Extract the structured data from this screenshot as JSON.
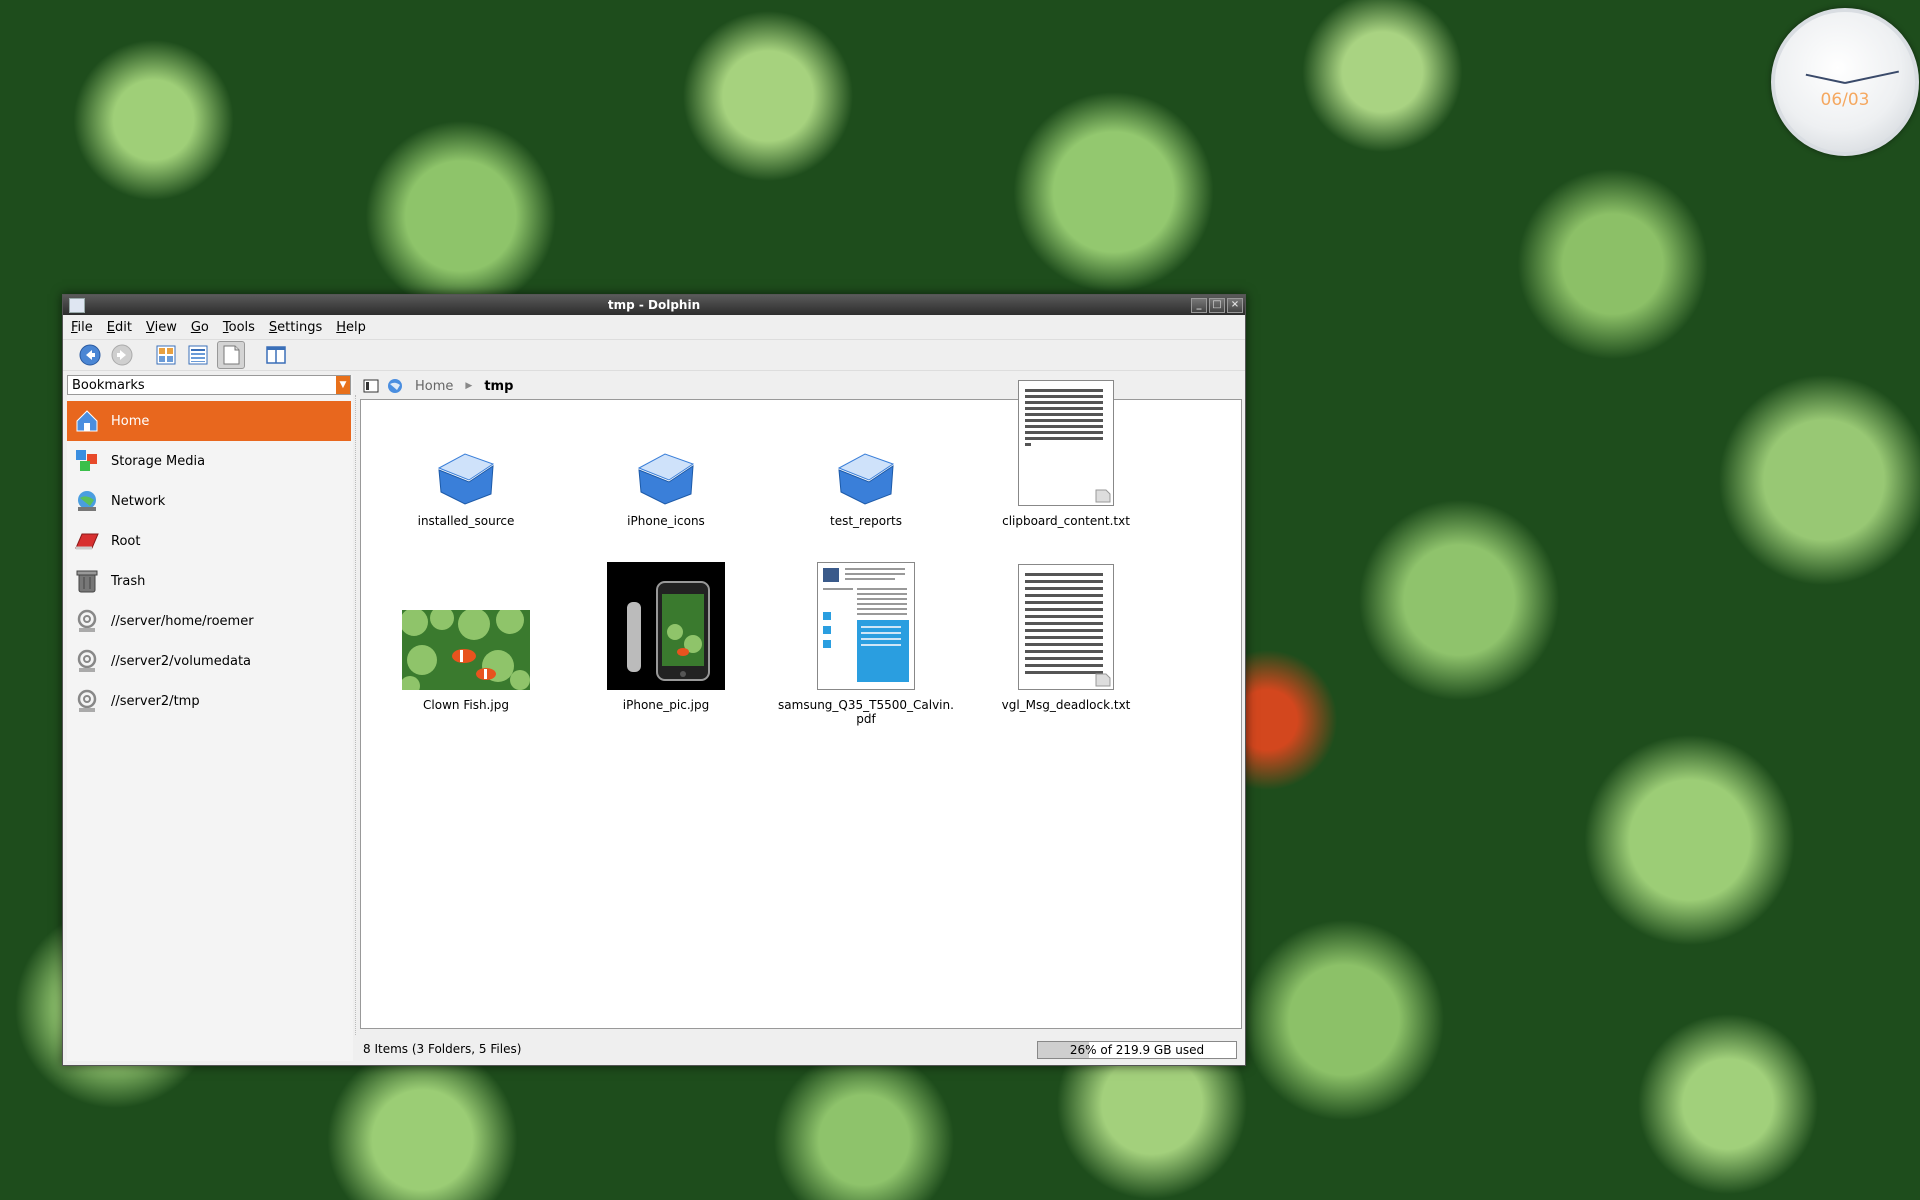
{
  "desktop": {
    "clock": {
      "date": "06/03"
    }
  },
  "window": {
    "title": "tmp - Dolphin",
    "menu": [
      "File",
      "Edit",
      "View",
      "Go",
      "Tools",
      "Settings",
      "Help"
    ],
    "toolbar": {
      "icons": [
        "back-icon",
        "forward-icon",
        "icons-view-icon",
        "details-view-icon",
        "preview-icon",
        "split-view-icon"
      ]
    },
    "sidebar": {
      "selector": "Bookmarks",
      "items": [
        {
          "label": "Home",
          "icon": "home-icon",
          "selected": true
        },
        {
          "label": "Storage Media",
          "icon": "storage-media-icon"
        },
        {
          "label": "Network",
          "icon": "network-icon"
        },
        {
          "label": "Root",
          "icon": "root-folder-icon"
        },
        {
          "label": "Trash",
          "icon": "trash-icon"
        },
        {
          "label": "//server/home/roemer",
          "icon": "network-share-icon"
        },
        {
          "label": "//server2/volumedata",
          "icon": "network-share-icon"
        },
        {
          "label": "//server2/tmp",
          "icon": "network-share-icon"
        }
      ]
    },
    "breadcrumb": {
      "home": "Home",
      "current": "tmp"
    },
    "files": [
      {
        "name": "installed_source",
        "type": "folder"
      },
      {
        "name": "iPhone_icons",
        "type": "folder"
      },
      {
        "name": "test_reports",
        "type": "folder"
      },
      {
        "name": "clipboard_content.txt",
        "type": "text"
      },
      {
        "name": "Clown Fish.jpg",
        "type": "image"
      },
      {
        "name": "iPhone_pic.jpg",
        "type": "image"
      },
      {
        "name_line1": "samsung_Q35_T5500_Calvin.",
        "name_line2": "pdf",
        "type": "pdf"
      },
      {
        "name": "vgl_Msg_deadlock.txt",
        "type": "text"
      }
    ],
    "status": {
      "summary": "8 Items (3 Folders, 5 Files)",
      "disk_label": "26% of 219.9 GB used",
      "disk_used_percent": 26
    },
    "colors": {
      "selection": "#e8671e",
      "accent_folder": "#3a7fd9"
    }
  }
}
